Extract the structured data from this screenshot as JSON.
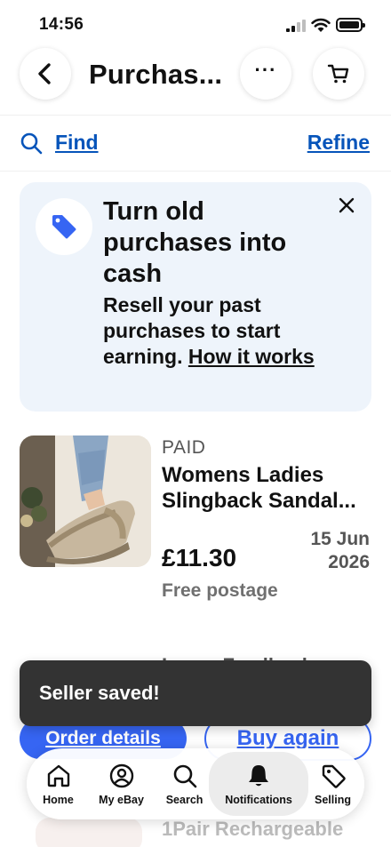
{
  "status_bar": {
    "time": "14:56"
  },
  "header": {
    "title": "Purchas...",
    "more_label": "···"
  },
  "filter_bar": {
    "find_label": "Find",
    "refine_label": "Refine"
  },
  "promo": {
    "title": "Turn old purchases into cash",
    "body": "Resell your past purchases to start earning.",
    "link_label": "How it works",
    "accent_color": "#3665f3"
  },
  "order": {
    "status": "PAID",
    "title": "Womens Ladies Slingback Sandal...",
    "price": "£11.30",
    "date_line1": "15 Jun",
    "date_line2": "2026",
    "shipping": "Free postage"
  },
  "background_item_text": "Leave Feedback",
  "buttons": {
    "order_details": "Order details",
    "buy_again": "Buy again"
  },
  "toast": {
    "message": "Seller saved!"
  },
  "next_item": {
    "title": "1Pair Rechargeable"
  },
  "nav": {
    "items": [
      {
        "label": "Home",
        "icon": "home-icon"
      },
      {
        "label": "My eBay",
        "icon": "user-icon"
      },
      {
        "label": "Search",
        "icon": "search-icon"
      },
      {
        "label": "Notifications",
        "icon": "bell-icon",
        "active": true
      },
      {
        "label": "Selling",
        "icon": "tag-icon"
      }
    ]
  },
  "colors": {
    "link": "#0654ba",
    "primary": "#3665f3",
    "toast_bg": "#333333",
    "promo_bg": "#eef4fb"
  }
}
